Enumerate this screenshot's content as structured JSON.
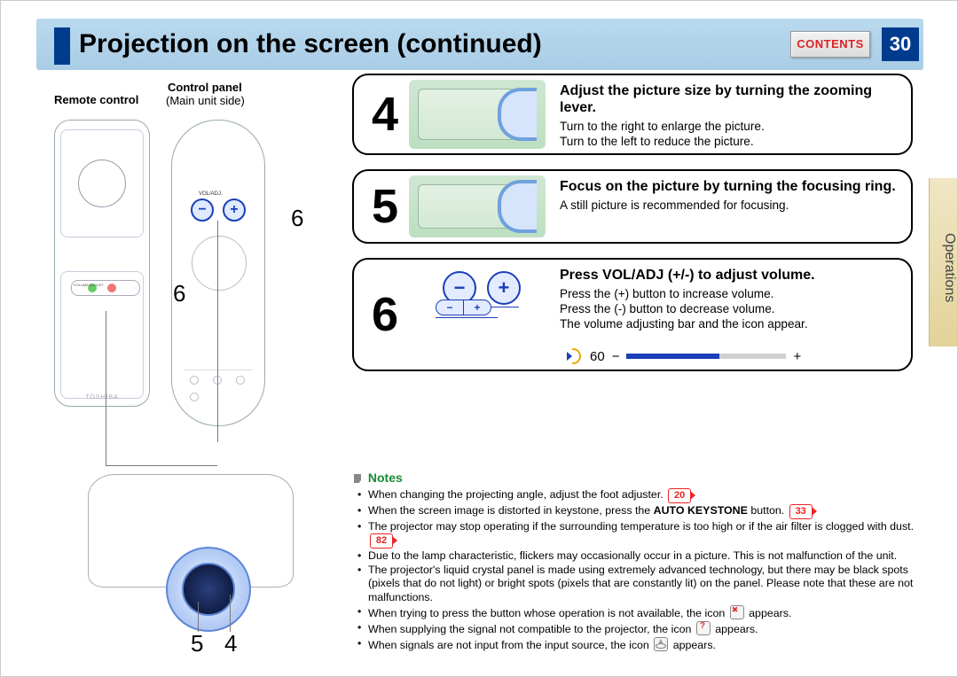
{
  "header": {
    "title": "Projection on the screen (continued)",
    "contents_label": "CONTENTS",
    "page_number": "30"
  },
  "side_tab": "Operations",
  "left": {
    "remote_label": "Remote control",
    "panel_label": "Control panel",
    "panel_sub": "(Main unit side)",
    "voladj_label": "VOL/ADJ.",
    "volume_label": "VOLUME/ADJUST",
    "brand": "TOSHIBA",
    "callout_6a": "6",
    "callout_6b": "6",
    "callout_5": "5",
    "callout_4": "4"
  },
  "steps": {
    "s4": {
      "num": "4",
      "title": "Adjust the picture size by turning the zooming lever.",
      "line1": "Turn to the right to enlarge the picture.",
      "line2": "Turn to the left to reduce the picture."
    },
    "s5": {
      "num": "5",
      "title": "Focus on the picture by turning the focusing ring.",
      "line1": "A still picture is recommended for focusing."
    },
    "s6": {
      "num": "6",
      "title": "Press VOL/ADJ (+/-) to adjust volume.",
      "line1": "Press the (+) button to increase volume.",
      "line2": "Press the (-) button to decrease volume.",
      "line3": "The volume adjusting bar and the icon appear.",
      "minus": "−",
      "plus": "+",
      "pill_minus": "−",
      "pill_plus": "+",
      "vol_value": "60",
      "vol_minus": "−",
      "vol_plus": "+"
    }
  },
  "notes": {
    "heading": "Notes",
    "n1a": "When changing the projecting angle, adjust the foot adjuster. ",
    "n1_ref": "20",
    "n2a": "When the screen image is distorted in keystone, press the ",
    "n2_bold": "AUTO KEYSTONE",
    "n2b": " button. ",
    "n2_ref": "33",
    "n3a": "The projector may stop operating if the surrounding temperature is too high or if the air filter is clogged with dust. ",
    "n3_ref": "82",
    "n4": "Due to the lamp characteristic, flickers may occasionally occur in a picture. This is not malfunction of the unit.",
    "n5": "The projector's liquid crystal panel is made using extremely advanced technology, but there may be black spots (pixels that do not light) or bright spots (pixels that are constantly lit) on the panel. Please note that these are not malfunctions.",
    "n6a": "When trying to press the button whose operation is not available, the icon ",
    "n6b": " appears.",
    "n7a": "When supplying the signal not compatible to the projector, the icon ",
    "n7b": " appears.",
    "n8a": "When signals are not input from the input source, the icon ",
    "n8b": " appears."
  }
}
